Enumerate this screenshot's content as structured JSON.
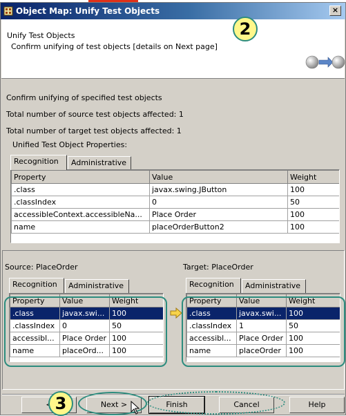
{
  "window": {
    "title": "Object Map: Unify Test Objects",
    "close_label": "×",
    "icon": "object-map-icon"
  },
  "header": {
    "title": "Unify Test Objects",
    "description": "Confirm unifying of test objects [details on Next page]",
    "graphic": "unify-arrow-graphic"
  },
  "callouts": {
    "step2": "2",
    "step3": "3"
  },
  "summary": {
    "line1": "Confirm unifying of specified test objects",
    "line2": "Total number of source test objects affected: 1",
    "line3": "Total number of target test objects affected: 1"
  },
  "unified": {
    "label": "Unified Test Object Properties:",
    "tabs": [
      "Recognition",
      "Administrative"
    ],
    "columns": [
      "Property",
      "Value",
      "Weight"
    ],
    "rows": [
      [
        ".class",
        "javax.swing.JButton",
        "100"
      ],
      [
        ".classIndex",
        "0",
        "50"
      ],
      [
        "accessibleContext.accessibleNa...",
        "Place Order",
        "100"
      ],
      [
        "name",
        "placeOrderButton2",
        "100"
      ]
    ]
  },
  "source": {
    "label": "Source: PlaceOrder",
    "tabs": [
      "Recognition",
      "Administrative"
    ],
    "columns": [
      "Property",
      "Value",
      "Weight"
    ],
    "rows": [
      [
        ".class",
        "javax.swi...",
        "100"
      ],
      [
        ".classIndex",
        "0",
        "50"
      ],
      [
        "accessibl...",
        "Place Order",
        "100"
      ],
      [
        "name",
        "placeOrd...",
        "100"
      ]
    ]
  },
  "target": {
    "label": "Target: PlaceOrder",
    "tabs": [
      "Recognition",
      "Administrative"
    ],
    "columns": [
      "Property",
      "Value",
      "Weight"
    ],
    "rows": [
      [
        ".class",
        "javax.swi...",
        "100"
      ],
      [
        ".classIndex",
        "1",
        "50"
      ],
      [
        "accessibl...",
        "Place Order",
        "100"
      ],
      [
        "name",
        "placeOrder",
        "100"
      ]
    ]
  },
  "buttons": {
    "back": "<",
    "next": "Next >",
    "finish": "Finish",
    "cancel": "Cancel",
    "help": "Help"
  },
  "colors": {
    "selection": "#0a246a",
    "callout_fill": "#fff78a",
    "annotation_outline": "#2c8c7e",
    "dialog_bg": "#d4d0c8"
  }
}
